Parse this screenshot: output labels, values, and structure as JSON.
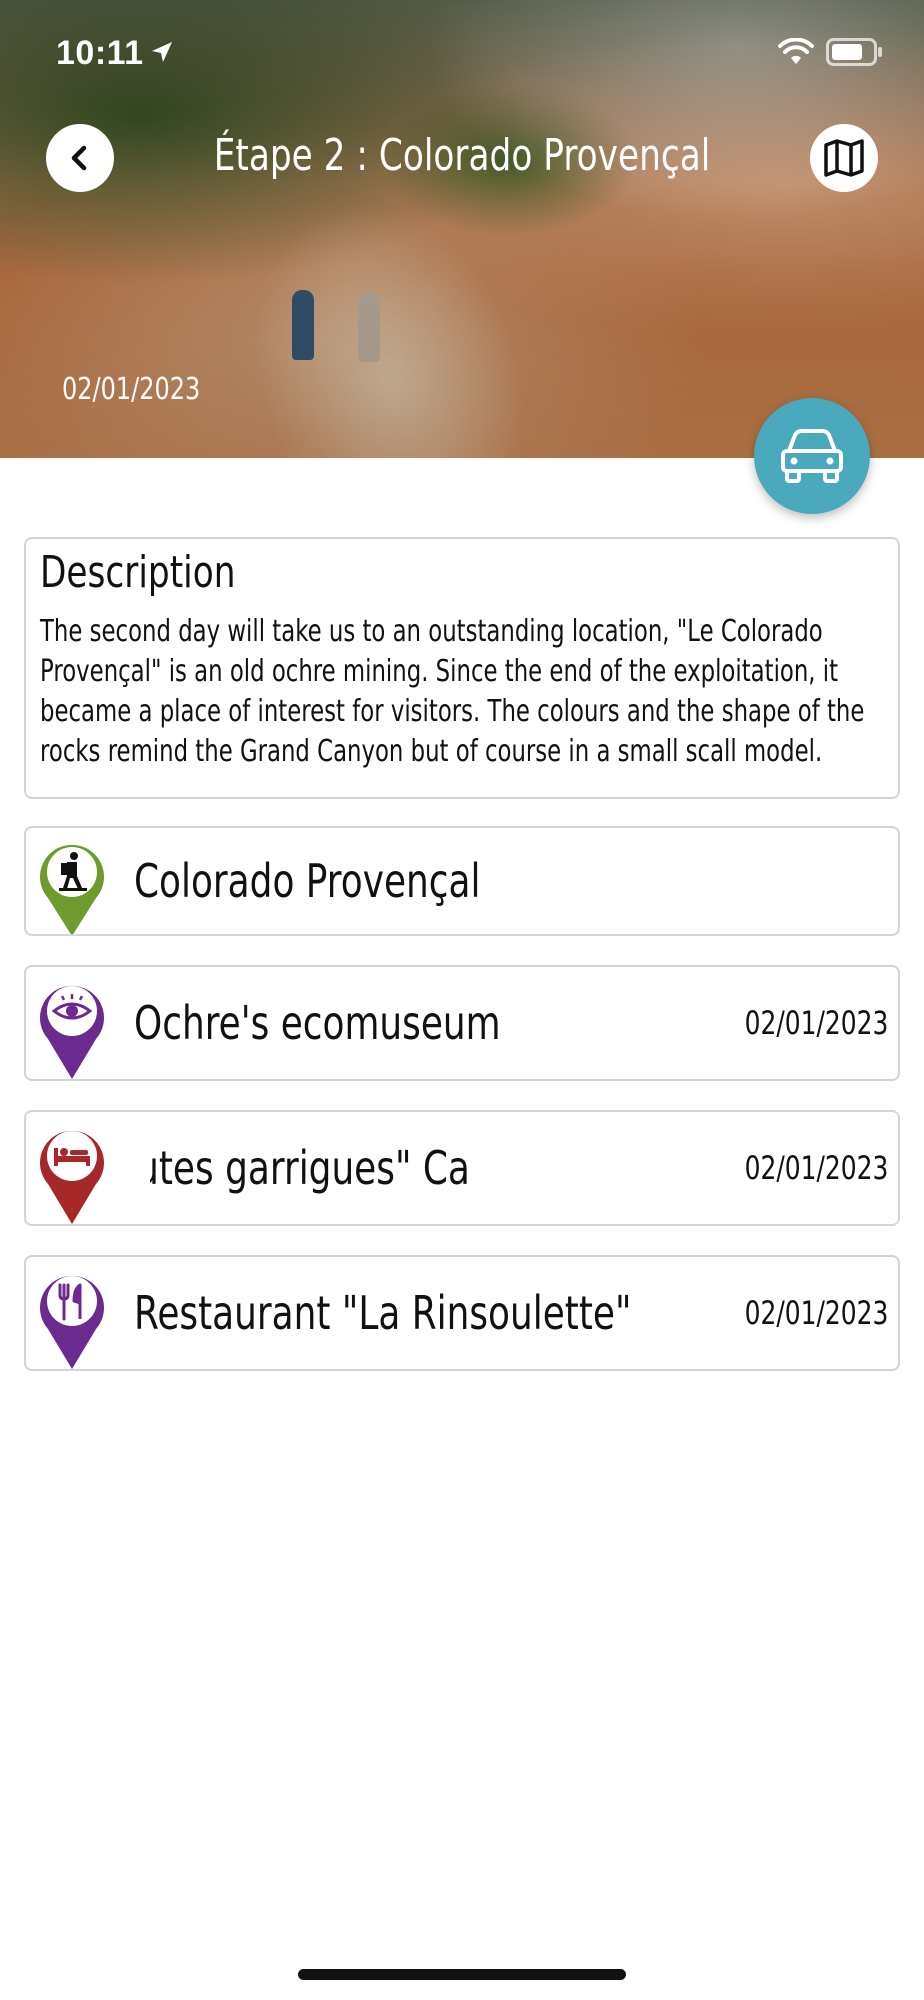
{
  "status_bar": {
    "time": "10:11"
  },
  "header": {
    "title": "Étape 2 : Colorado Provençal",
    "date": "02/01/2023"
  },
  "description": {
    "heading": "Description",
    "text": "The second day will take us to an outstanding location, \"Le Colorado Provençal\" is an old ochre mining. Since the end of the exploitation, it became a place of interest for visitors. The colours and the shape of the rocks remind the Grand Canyon but of course in a small scall model."
  },
  "stops": [
    {
      "name": "Colorado Provençal",
      "date": "",
      "icon": "hiking-icon",
      "color": "#6e9a2e"
    },
    {
      "name": "Ochre's ecomuseum",
      "date": "02/01/2023",
      "icon": "eye-icon",
      "color": "#6a2a8e"
    },
    {
      "name": "Gîte \"Les hautes garrigues\"       Ca",
      "date": "02/01/2023",
      "icon": "bed-icon",
      "color": "#a8282a"
    },
    {
      "name": "Restaurant \"La Rinsoulette\"",
      "date": "02/01/2023",
      "icon": "cutlery-icon",
      "color": "#6a2a8e"
    }
  ],
  "colors": {
    "accent": "#4aa9bd",
    "border": "#d4d4d4"
  }
}
